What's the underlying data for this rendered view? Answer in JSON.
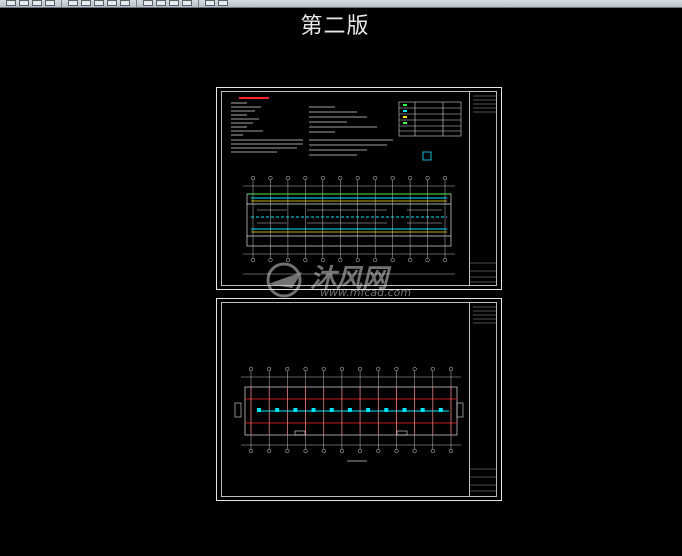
{
  "toolbar": {
    "icon_count": 16
  },
  "header": {
    "version_label": "第二版"
  },
  "watermark": {
    "logo_text": "沐风网",
    "url": "www.mfcad.com"
  },
  "colors": {
    "background": "#000000",
    "frame": "#e6e6e6",
    "cyan": "#00e5ff",
    "red": "#ff2020",
    "yellow": "#ffe600",
    "green": "#3cff3c"
  },
  "drawings": {
    "sheet1": {
      "axis_count_top": 12,
      "axis_count_bottom": 12
    },
    "sheet2": {
      "axis_count_top": 12,
      "axis_count_bottom": 12
    }
  }
}
